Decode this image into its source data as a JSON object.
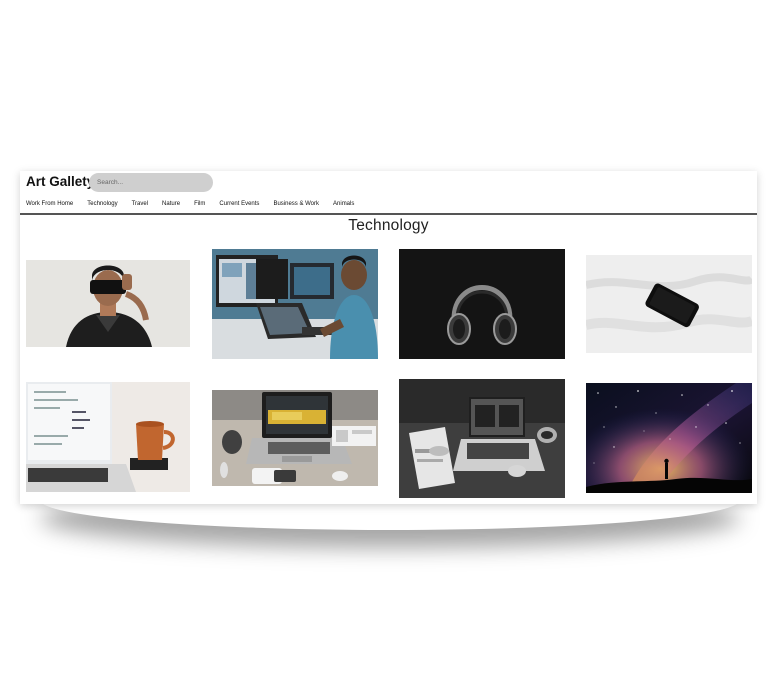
{
  "app": {
    "brand": "Art Gallety",
    "search_placeholder": "Search..."
  },
  "nav": {
    "items": [
      "Work From Home",
      "Technology",
      "Travel",
      "Nature",
      "Film",
      "Current Events",
      "Business & Work",
      "Animals"
    ]
  },
  "page": {
    "title": "Technology"
  },
  "gallery": {
    "images": [
      {
        "subject": "person-vr-headset"
      },
      {
        "subject": "man-at-computer-desk"
      },
      {
        "subject": "headphones-dark"
      },
      {
        "subject": "phone-on-white-sheet"
      },
      {
        "subject": "laptop-and-mug"
      },
      {
        "subject": "laptop-on-desk"
      },
      {
        "subject": "laptop-clock-desk"
      },
      {
        "subject": "milky-way-night-sky"
      }
    ]
  },
  "palette": {
    "search_bg": "#cfcfcf",
    "divider": "#555555"
  }
}
